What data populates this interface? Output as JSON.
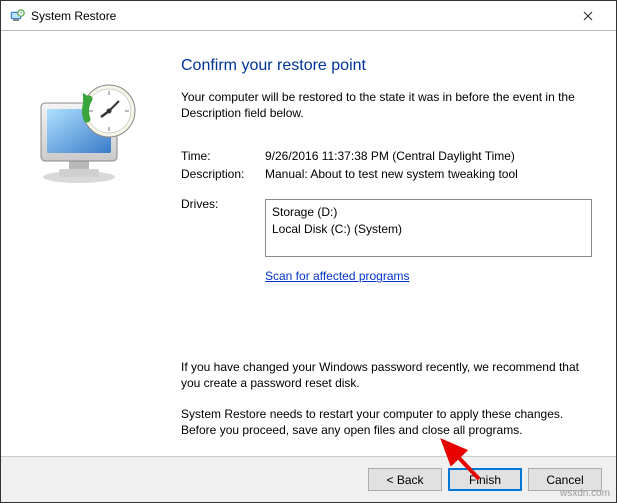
{
  "window": {
    "title": "System Restore"
  },
  "heading": "Confirm your restore point",
  "intro": "Your computer will be restored to the state it was in before the event in the Description field below.",
  "fields": {
    "time_label": "Time:",
    "time_value": "9/26/2016 11:37:38 PM (Central Daylight Time)",
    "description_label": "Description:",
    "description_value": "Manual: About to test new system tweaking tool",
    "drives_label": "Drives:",
    "drives_values": [
      "Storage (D:)",
      "Local Disk (C:) (System)"
    ]
  },
  "scan_link": "Scan for affected programs",
  "note_password": "If you have changed your Windows password recently, we recommend that you create a password reset disk.",
  "note_restart": "System Restore needs to restart your computer to apply these changes. Before you proceed, save any open files and close all programs.",
  "buttons": {
    "back": "< Back",
    "finish": "Finish",
    "cancel": "Cancel"
  },
  "watermark": "wsxdn.com"
}
